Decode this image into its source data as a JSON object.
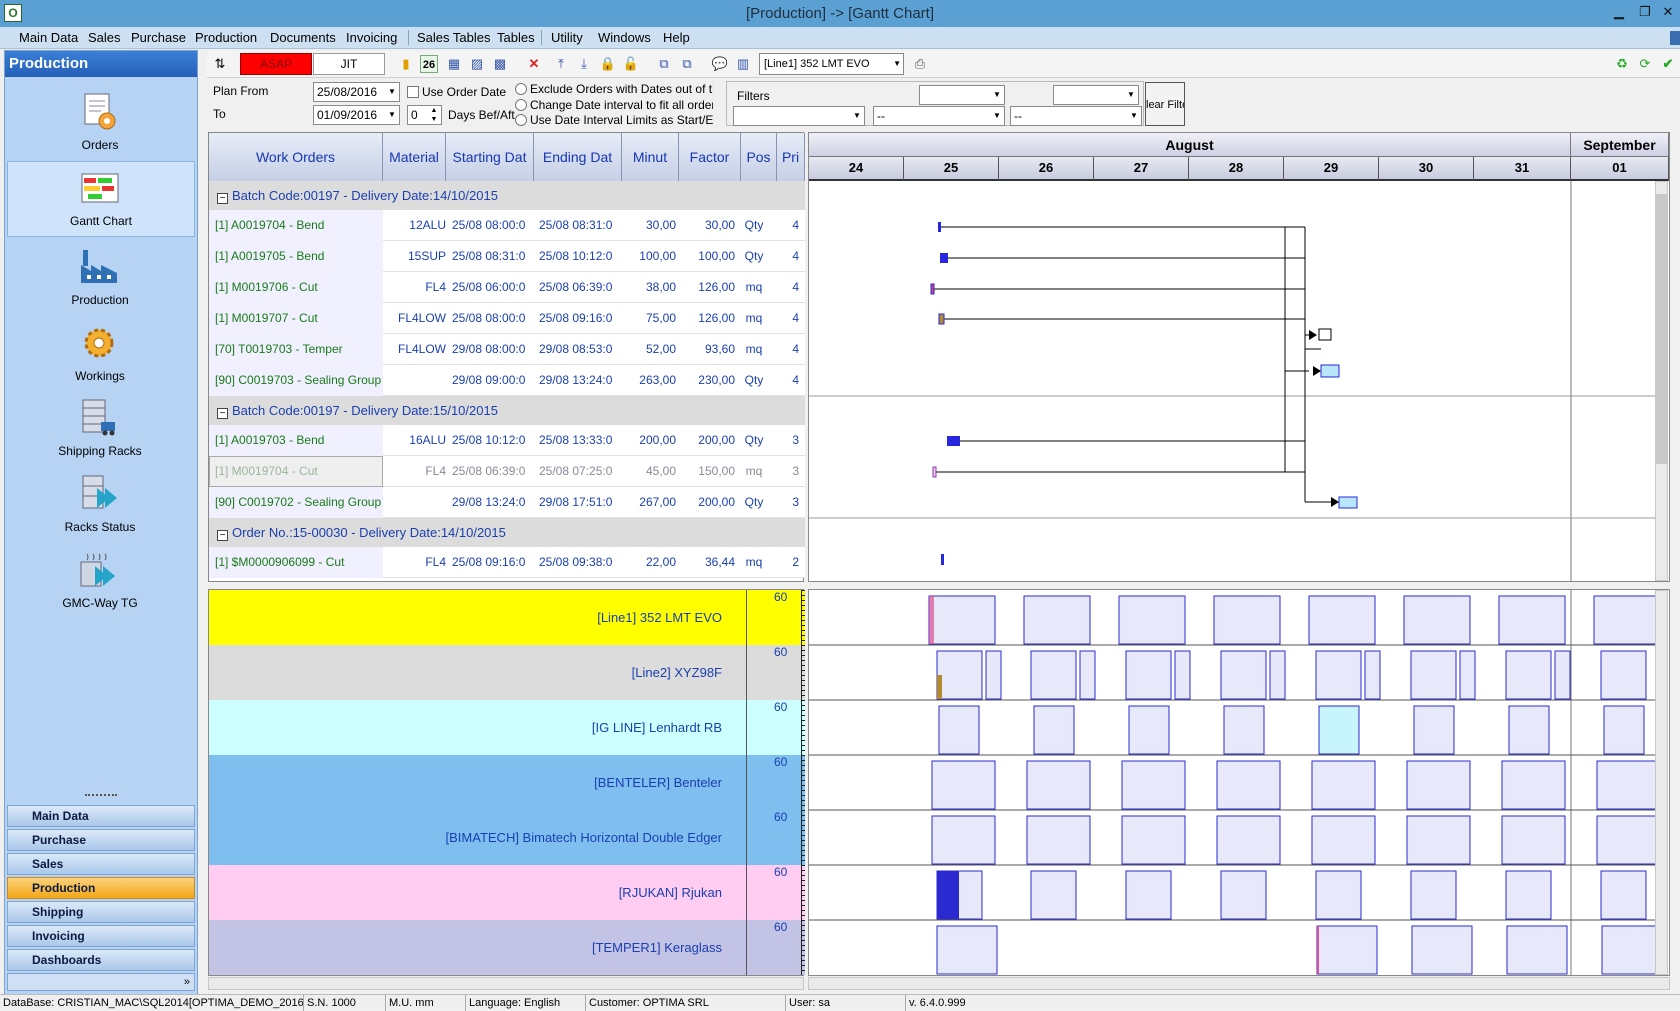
{
  "window": {
    "title": "[Production] -> [Gantt Chart]"
  },
  "menu": [
    "Main Data",
    "Sales",
    "Purchase",
    "Production",
    "Documents",
    "Invoicing",
    "Sales Tables",
    "Tables",
    "Utility",
    "Windows",
    "Help"
  ],
  "left": {
    "header": "Production",
    "items": [
      {
        "label": "Orders",
        "icon": "orders-icon"
      },
      {
        "label": "Gantt Chart",
        "icon": "gantt-chart-icon"
      },
      {
        "label": "Production",
        "icon": "factory-icon"
      },
      {
        "label": "Workings",
        "icon": "gear-icon"
      },
      {
        "label": "Shipping Racks",
        "icon": "shipping-racks-icon"
      },
      {
        "label": "Racks Status",
        "icon": "racks-status-icon"
      },
      {
        "label": "GMC-Way TG",
        "icon": "gmc-way-icon"
      }
    ],
    "modules": [
      "Main Data",
      "Purchase",
      "Sales",
      "Production",
      "Shipping",
      "Invoicing",
      "Dashboards"
    ],
    "active_module": "Production"
  },
  "toolbar": {
    "asap": "ASAP",
    "jit": "JIT",
    "calendar_day": "26",
    "line_select": "[Line1] 352 LMT EVO"
  },
  "plan": {
    "plan_from_label": "Plan From",
    "plan_from": "25/08/2016",
    "to_label": "To",
    "to": "01/09/2016",
    "use_order_date": "Use Order Date",
    "days_value": "0",
    "days_label": "Days Bef/Aft",
    "opt1": "Exclude Orders with Dates out of the ir",
    "opt2": "Change Date interval to fit all orders",
    "opt3": "Use Date Interval Limits as Start/End D",
    "filters_label": "Filters",
    "filter_placeholder": "--",
    "clear_filter": "lear Filte"
  },
  "grid": {
    "headers": [
      "Work Orders",
      "Material",
      "Starting Dat",
      "Ending Dat",
      "Minut",
      "Factor",
      "Pos",
      "Pri"
    ],
    "groups": [
      {
        "title": "Batch Code:00197 - Delivery Date:14/10/2015",
        "rows": [
          [
            "[1] A0019704 - Bend",
            "12ALU",
            "25/08 08:00:0",
            "25/08 08:31:0",
            "30,00",
            "30,00",
            "Qty",
            "4"
          ],
          [
            "[1] A0019705 - Bend",
            "15SUP",
            "25/08 08:31:0",
            "25/08 10:12:0",
            "100,00",
            "100,00",
            "Qty",
            "4"
          ],
          [
            "[1] M0019706 - Cut",
            "FL4",
            "25/08 06:00:0",
            "25/08 06:39:0",
            "38,00",
            "126,00",
            "mq",
            "4"
          ],
          [
            "[1] M0019707 - Cut",
            "FL4LOW",
            "25/08 08:00:0",
            "25/08 09:16:0",
            "75,00",
            "126,00",
            "mq",
            "4"
          ],
          [
            "[70] T0019703 - Temper",
            "FL4LOW",
            "29/08 08:00:0",
            "29/08 08:53:0",
            "52,00",
            "93,60",
            "mq",
            "4"
          ],
          [
            "[90] C0019703 - Sealing Group",
            "",
            "29/08 09:00:0",
            "29/08 13:24:0",
            "263,00",
            "230,00",
            "Qty",
            "4"
          ]
        ]
      },
      {
        "title": "Batch Code:00197 - Delivery Date:15/10/2015",
        "rows": [
          [
            "[1] A0019703 - Bend",
            "16ALU",
            "25/08 10:12:0",
            "25/08 13:33:0",
            "200,00",
            "200,00",
            "Qty",
            "3"
          ],
          [
            "[1] M0019704 - Cut",
            "FL4",
            "25/08 06:39:0",
            "25/08 07:25:0",
            "45,00",
            "150,00",
            "mq",
            "3"
          ],
          [
            "[90] C0019702 - Sealing Group",
            "",
            "29/08 13:24:0",
            "29/08 17:51:0",
            "267,00",
            "200,00",
            "Qty",
            "3"
          ]
        ]
      },
      {
        "title": "Order No.:15-00030 - Delivery Date:14/10/2015",
        "rows": [
          [
            "[1] $M0000906099 - Cut",
            "FL4",
            "25/08 09:16:0",
            "25/08 09:38:0",
            "22,00",
            "36,44",
            "mq",
            "2"
          ]
        ]
      }
    ]
  },
  "gantt": {
    "months": [
      "August",
      "September"
    ],
    "days": [
      "24",
      "25",
      "26",
      "27",
      "28",
      "29",
      "30",
      "31",
      "01"
    ]
  },
  "resources": [
    {
      "name": "[Line1] 352 LMT EVO",
      "scale": "60",
      "color": "#ffff00"
    },
    {
      "name": "[Line2] XYZ98F",
      "scale": "60",
      "color": "#dcdcdc"
    },
    {
      "name": "[IG LINE] Lenhardt RB",
      "scale": "60",
      "color": "#ccffff"
    },
    {
      "name": "[BENTELER] Benteler",
      "scale": "60",
      "color": "#7fbff0"
    },
    {
      "name": "[BIMATECH] Bimatech Horizontal Double Edger",
      "scale": "60",
      "color": "#7fbff0"
    },
    {
      "name": "[RJUKAN] Rjukan",
      "scale": "60",
      "color": "#ffccf2"
    },
    {
      "name": "[TEMPER1] Keraglass",
      "scale": "60",
      "color": "#c3c3e6"
    }
  ],
  "status": {
    "database": "DataBase: CRISTIAN_MAC\\SQL2014[OPTIMA_DEMO_2016]",
    "sn": "S.N. 1000",
    "mu": "M.U. mm",
    "language": "Language: English",
    "customer": "Customer: OPTIMA SRL",
    "user": "User: sa",
    "version": "v. 6.4.0.999"
  }
}
